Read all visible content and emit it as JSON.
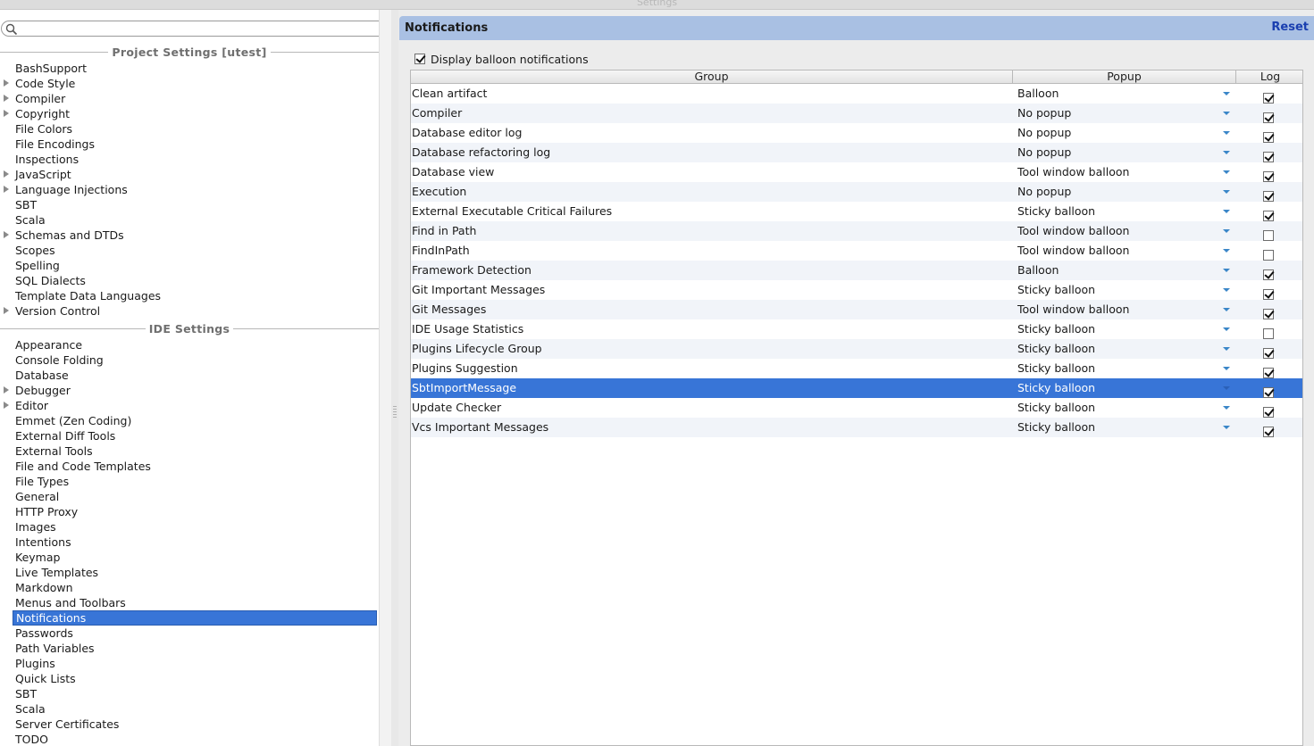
{
  "window": {
    "title": "Settings"
  },
  "search": {
    "placeholder": ""
  },
  "sidebar": {
    "project_header": "Project Settings [utest]",
    "project_items": [
      {
        "label": "BashSupport",
        "expandable": false
      },
      {
        "label": "Code Style",
        "expandable": true
      },
      {
        "label": "Compiler",
        "expandable": true
      },
      {
        "label": "Copyright",
        "expandable": true
      },
      {
        "label": "File Colors",
        "expandable": false
      },
      {
        "label": "File Encodings",
        "expandable": false
      },
      {
        "label": "Inspections",
        "expandable": false
      },
      {
        "label": "JavaScript",
        "expandable": true
      },
      {
        "label": "Language Injections",
        "expandable": true
      },
      {
        "label": "SBT",
        "expandable": false
      },
      {
        "label": "Scala",
        "expandable": false
      },
      {
        "label": "Schemas and DTDs",
        "expandable": true
      },
      {
        "label": "Scopes",
        "expandable": false
      },
      {
        "label": "Spelling",
        "expandable": false
      },
      {
        "label": "SQL Dialects",
        "expandable": false
      },
      {
        "label": "Template Data Languages",
        "expandable": false
      },
      {
        "label": "Version Control",
        "expandable": true
      }
    ],
    "ide_header": "IDE Settings",
    "ide_items": [
      {
        "label": "Appearance",
        "expandable": false
      },
      {
        "label": "Console Folding",
        "expandable": false
      },
      {
        "label": "Database",
        "expandable": false
      },
      {
        "label": "Debugger",
        "expandable": true
      },
      {
        "label": "Editor",
        "expandable": true
      },
      {
        "label": "Emmet (Zen Coding)",
        "expandable": false
      },
      {
        "label": "External Diff Tools",
        "expandable": false
      },
      {
        "label": "External Tools",
        "expandable": false
      },
      {
        "label": "File and Code Templates",
        "expandable": false
      },
      {
        "label": "File Types",
        "expandable": false
      },
      {
        "label": "General",
        "expandable": false
      },
      {
        "label": "HTTP Proxy",
        "expandable": false
      },
      {
        "label": "Images",
        "expandable": false
      },
      {
        "label": "Intentions",
        "expandable": false
      },
      {
        "label": "Keymap",
        "expandable": false
      },
      {
        "label": "Live Templates",
        "expandable": false
      },
      {
        "label": "Markdown",
        "expandable": false
      },
      {
        "label": "Menus and Toolbars",
        "expandable": false
      },
      {
        "label": "Notifications",
        "expandable": false,
        "selected": true
      },
      {
        "label": "Passwords",
        "expandable": false
      },
      {
        "label": "Path Variables",
        "expandable": false
      },
      {
        "label": "Plugins",
        "expandable": false
      },
      {
        "label": "Quick Lists",
        "expandable": false
      },
      {
        "label": "SBT",
        "expandable": false
      },
      {
        "label": "Scala",
        "expandable": false
      },
      {
        "label": "Server Certificates",
        "expandable": false
      },
      {
        "label": "TODO",
        "expandable": false
      }
    ]
  },
  "panel": {
    "title": "Notifications",
    "reset_label": "Reset",
    "display_balloon": {
      "label": "Display balloon notifications",
      "checked": true
    },
    "table": {
      "columns": {
        "group": "Group",
        "popup": "Popup",
        "log": "Log"
      },
      "rows": [
        {
          "group": "Clean artifact",
          "popup": "Balloon",
          "log": true
        },
        {
          "group": "Compiler",
          "popup": "No popup",
          "log": true
        },
        {
          "group": "Database editor log",
          "popup": "No popup",
          "log": true
        },
        {
          "group": "Database refactoring log",
          "popup": "No popup",
          "log": true
        },
        {
          "group": "Database view",
          "popup": "Tool window balloon",
          "log": true
        },
        {
          "group": "Execution",
          "popup": "No popup",
          "log": true
        },
        {
          "group": "External Executable Critical Failures",
          "popup": "Sticky balloon",
          "log": true
        },
        {
          "group": "Find in Path",
          "popup": "Tool window balloon",
          "log": false
        },
        {
          "group": "FindInPath",
          "popup": "Tool window balloon",
          "log": false
        },
        {
          "group": "Framework Detection",
          "popup": "Balloon",
          "log": true
        },
        {
          "group": "Git Important Messages",
          "popup": "Sticky balloon",
          "log": true
        },
        {
          "group": "Git Messages",
          "popup": "Tool window balloon",
          "log": true
        },
        {
          "group": "IDE Usage Statistics",
          "popup": "Sticky balloon",
          "log": false
        },
        {
          "group": "Plugins Lifecycle Group",
          "popup": "Sticky balloon",
          "log": true
        },
        {
          "group": "Plugins Suggestion",
          "popup": "Sticky balloon",
          "log": true
        },
        {
          "group": "SbtImportMessage",
          "popup": "Sticky balloon",
          "log": true,
          "selected": true
        },
        {
          "group": "Update Checker",
          "popup": "Sticky balloon",
          "log": true
        },
        {
          "group": "Vcs Important Messages",
          "popup": "Sticky balloon",
          "log": true
        }
      ]
    }
  },
  "colors": {
    "selection": "#3875d7",
    "header": "#a9c0e3",
    "reset_link": "#1a3fb0"
  }
}
